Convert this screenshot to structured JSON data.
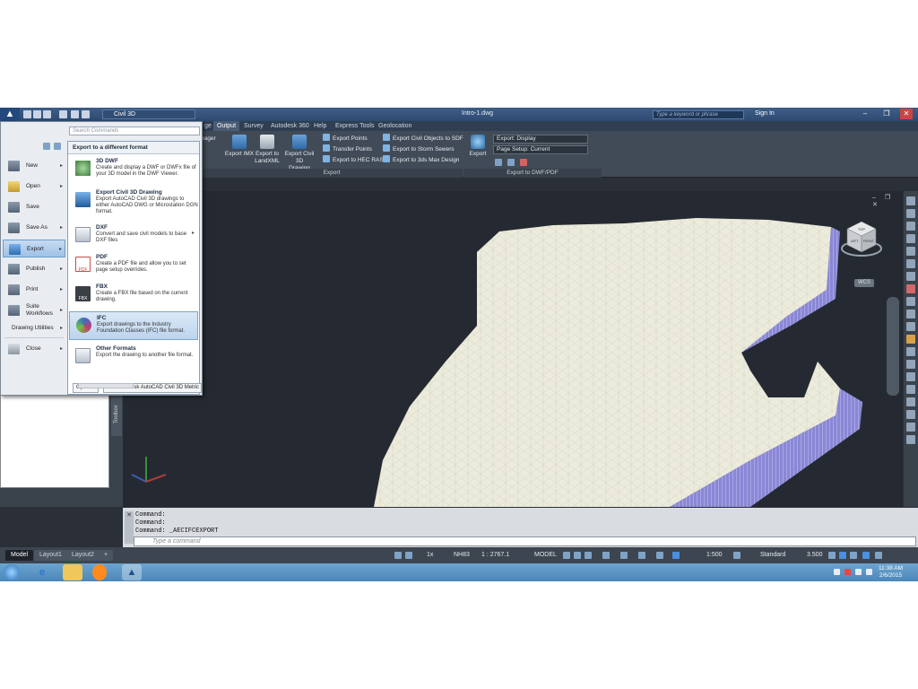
{
  "title_bar": {
    "app_letter": "▲",
    "workspace": "Civil 3D",
    "document": "Intro-1.dwg",
    "search_placeholder": "Type a keyword or phrase",
    "sign_in": "Sign In"
  },
  "ribbon": {
    "tabs": [
      "ge",
      "Output",
      "Survey",
      "Autodesk 360",
      "Help",
      "Express Tools",
      "Geolocation"
    ],
    "active_tab": "Output",
    "partial_label_1": "nager",
    "partial_label_2": "r",
    "buttons": {
      "export_imx": "Export IMX",
      "export_landxml_1": "Export to",
      "export_landxml_2": "LandXML",
      "export_c3d_1": "Export Civil 3D",
      "export_c3d_2": "Drawing",
      "export_points": "Export Points",
      "transfer_points": "Transfer Points",
      "export_hec": "Export to HEC RAS",
      "export_sdf": "Export Civil Objects to SDF",
      "export_storm": "Export to Storm Sewers",
      "export_3ds": "Export to 3ds Max Design",
      "export_big": "Export"
    },
    "dropdowns": {
      "export_display": "Export: Display",
      "page_setup": "Page Setup: Current"
    },
    "panels": {
      "export": "Export",
      "export_dwf": "Export to DWF/PDF"
    }
  },
  "app_menu": {
    "search_placeholder": "Search Commands",
    "left_items": [
      {
        "label": "New",
        "arrow": "▸"
      },
      {
        "label": "Open",
        "arrow": "▸"
      },
      {
        "label": "Save",
        "arrow": ""
      },
      {
        "label": "Save As",
        "arrow": "▸"
      },
      {
        "label": "Export",
        "arrow": "▸"
      },
      {
        "label": "Publish",
        "arrow": "▸"
      },
      {
        "label": "Print",
        "arrow": "▸"
      },
      {
        "label": "Suite Workflows",
        "arrow": "▸"
      },
      {
        "label": "Drawing Utilities",
        "arrow": "▸"
      },
      {
        "label": "Close",
        "arrow": "▸"
      }
    ],
    "submenu_title": "Export to a different format",
    "submenu_items": [
      {
        "title": "3D DWF",
        "desc": "Create and display a DWF or DWFx file of your 3D model in the DWF Viewer."
      },
      {
        "title": "Export Civil 3D Drawing",
        "desc": "Export AutoCAD Civil 3D drawings to either AutoCAD DWG or Microstation DGN format."
      },
      {
        "title": "DXF",
        "desc": "Convert and save civil models to base DXF files"
      },
      {
        "title": "PDF",
        "desc": "Create a PDF file and allow you to set page setup overrides."
      },
      {
        "title": "FBX",
        "desc": "Create a FBX file based on the current drawing."
      },
      {
        "title": "IFC",
        "desc": "Export drawings to the Industry Foundation Classes (IFC) file format."
      },
      {
        "title": "Other Formats",
        "desc": "Export the drawing to another file format."
      }
    ],
    "icon_labels": {
      "pdf": "PDF",
      "fbx": "FBX"
    },
    "options_button": "Options",
    "exit_button": "Exit Autodesk AutoCAD Civil 3D Metric"
  },
  "viewport": {
    "wcs": "WCS",
    "viewcube_top": "TOP",
    "viewcube_front": "FRONT",
    "viewcube_left": "LEFT"
  },
  "toolbox_tab": "Toolbox",
  "command_line": {
    "history": [
      "Command:",
      "Command:",
      "Command: _AECIFCEXPORT"
    ],
    "placeholder": "Type a command"
  },
  "layout_tabs": [
    "Model",
    "Layout1",
    "Layout2"
  ],
  "status_bar": {
    "scale_x": "1x",
    "coord_system": "NH83",
    "ratio": "1 : 2767.1",
    "space": "MODEL",
    "scale": "1:500",
    "style": "Standard",
    "elevation": "3.500"
  },
  "taskbar": {
    "time": "11:38 AM",
    "date": "2/6/2015"
  },
  "colors": {
    "accent": "#3f6db0",
    "surface_side": "#8a87d6",
    "surface_top": "#ecebdc"
  }
}
